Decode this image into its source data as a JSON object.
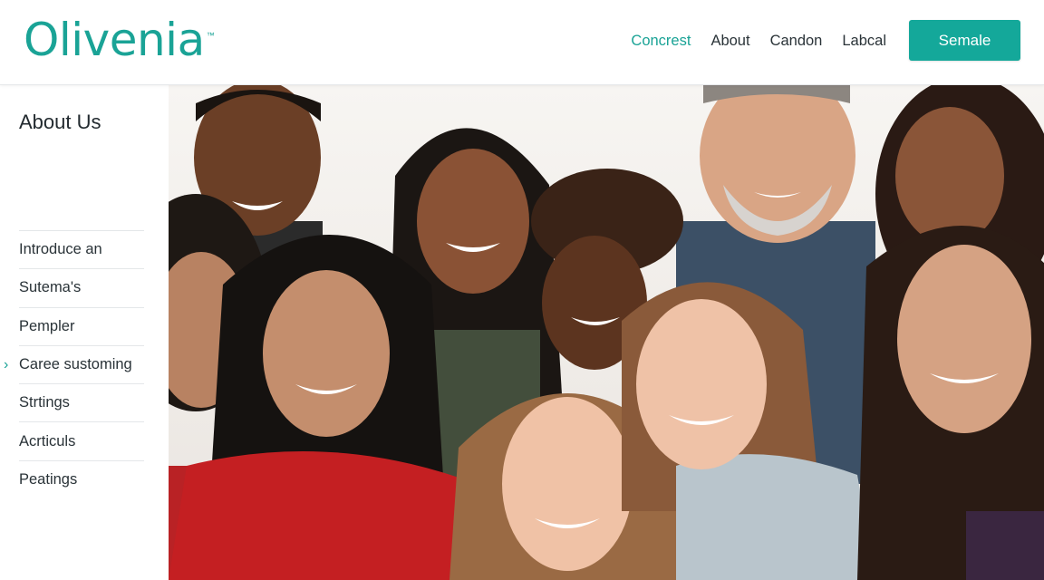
{
  "brand": {
    "name": "Olivenia",
    "tm": "™",
    "color": "#1aa396"
  },
  "nav": {
    "items": [
      {
        "label": "Concrest",
        "active": true
      },
      {
        "label": "About",
        "active": false
      },
      {
        "label": "Candon",
        "active": false
      },
      {
        "label": "Labcal",
        "active": false
      }
    ],
    "cta_label": "Semale",
    "cta_color": "#14a89a"
  },
  "sidebar": {
    "title": "About Us",
    "items": [
      {
        "label": "Introduce an"
      },
      {
        "label": "Sutema's"
      },
      {
        "label": "Pempler"
      },
      {
        "label": "Caree sustoming",
        "selected": true
      },
      {
        "label": "Strtings"
      },
      {
        "label": "Acrticuls"
      },
      {
        "label": "Peatings"
      }
    ]
  },
  "hero": {
    "icon": "group-photo"
  }
}
